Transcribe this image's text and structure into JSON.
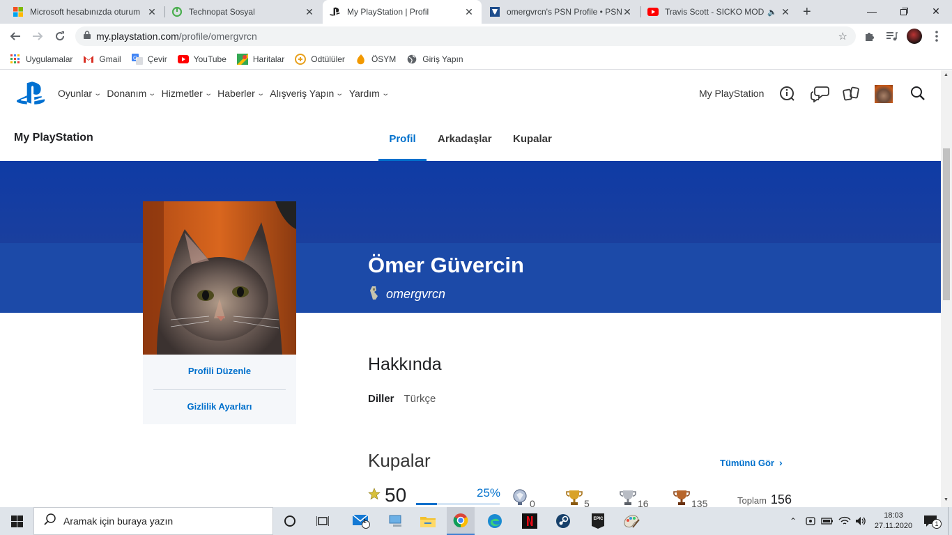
{
  "browser": {
    "tabs": [
      {
        "title": "Microsoft hesabınızda oturum",
        "icon": "microsoft-icon",
        "active": false
      },
      {
        "title": "Technopat Sosyal",
        "icon": "technopat-icon",
        "active": false
      },
      {
        "title": "My PlayStation | Profil",
        "icon": "playstation-icon",
        "active": true
      },
      {
        "title": "omergvrcn's PSN Profile • PSN",
        "icon": "psnprofiles-icon",
        "active": false
      },
      {
        "title": "Travis Scott - SICKO MODE",
        "icon": "youtube-icon",
        "active": false
      }
    ],
    "url_host": "my.playstation.com",
    "url_path": "/profile/omergvrcn",
    "bookmarks": [
      {
        "label": "Uygulamalar",
        "icon": "apps-grid-icon"
      },
      {
        "label": "Gmail",
        "icon": "gmail-icon"
      },
      {
        "label": "Çevir",
        "icon": "translate-icon"
      },
      {
        "label": "YouTube",
        "icon": "youtube-icon"
      },
      {
        "label": "Haritalar",
        "icon": "maps-icon"
      },
      {
        "label": "Odtülüler",
        "icon": "odtululer-icon"
      },
      {
        "label": "ÖSYM",
        "icon": "osym-icon"
      },
      {
        "label": "Giriş Yapın",
        "icon": "globe-icon"
      }
    ]
  },
  "site": {
    "nav": [
      "Oyunlar",
      "Donanım",
      "Hizmetler",
      "Haberler",
      "Alışveriş Yapın",
      "Yardım"
    ],
    "my_playstation_link": "My PlayStation",
    "brand_title": "My PlayStation",
    "subtabs": [
      "Profil",
      "Arkadaşlar",
      "Kupalar"
    ],
    "active_subtab": "Profil"
  },
  "profile": {
    "display_name": "Ömer Güvercin",
    "online_id": "omergvrcn",
    "actions": [
      "Profili Düzenle",
      "Gizlilik Ayarları"
    ],
    "about_heading": "Hakkında",
    "languages_label": "Diller",
    "languages_value": "Türkçe"
  },
  "trophies": {
    "heading": "Kupalar",
    "see_all": "Tümünü Gör",
    "level": "50",
    "progress_label": "25%",
    "progress": 0.25,
    "platinum": "0",
    "gold": "5",
    "silver": "16",
    "bronze": "135",
    "total_label": "Toplam",
    "total": "156"
  },
  "taskbar": {
    "search_placeholder": "Aramak için buraya yazın",
    "time": "18:03",
    "date": "27.11.2020",
    "notification_count": "1",
    "mail_badge": "1"
  },
  "colors": {
    "ps_blue": "#0070cc",
    "banner_top": "#0f3ba5",
    "banner_bottom": "#1c4aa8"
  }
}
